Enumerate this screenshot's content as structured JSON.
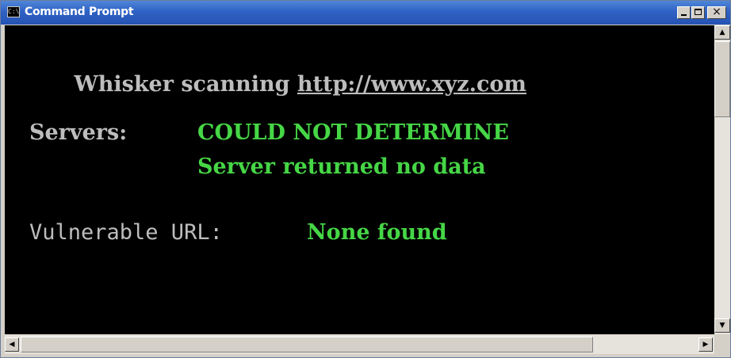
{
  "window": {
    "title": "Command Prompt",
    "icon": "cmd-icon",
    "icon_glyph": "C:\\",
    "controls": {
      "minimize": "minimize-icon",
      "maximize": "maximize-icon",
      "close": "close-icon",
      "close_glyph": "×"
    }
  },
  "console": {
    "line1_prefix": "Whisker scanning ",
    "line1_url": "http://www.xyz.com",
    "servers_label": "Servers:",
    "servers_value_1": "COULD NOT DETERMINE",
    "servers_value_2": "Server returned no data",
    "vuln_label": "Vulnerable URL:",
    "vuln_value": "None found"
  },
  "scrollbars": {
    "up_glyph": "▲",
    "down_glyph": "▼",
    "left_glyph": "◀",
    "right_glyph": "▶"
  },
  "colors": {
    "titlebar": "#2f62c4",
    "console_bg": "#000000",
    "gray_text": "#bdbdbd",
    "green_text": "#46d646"
  }
}
